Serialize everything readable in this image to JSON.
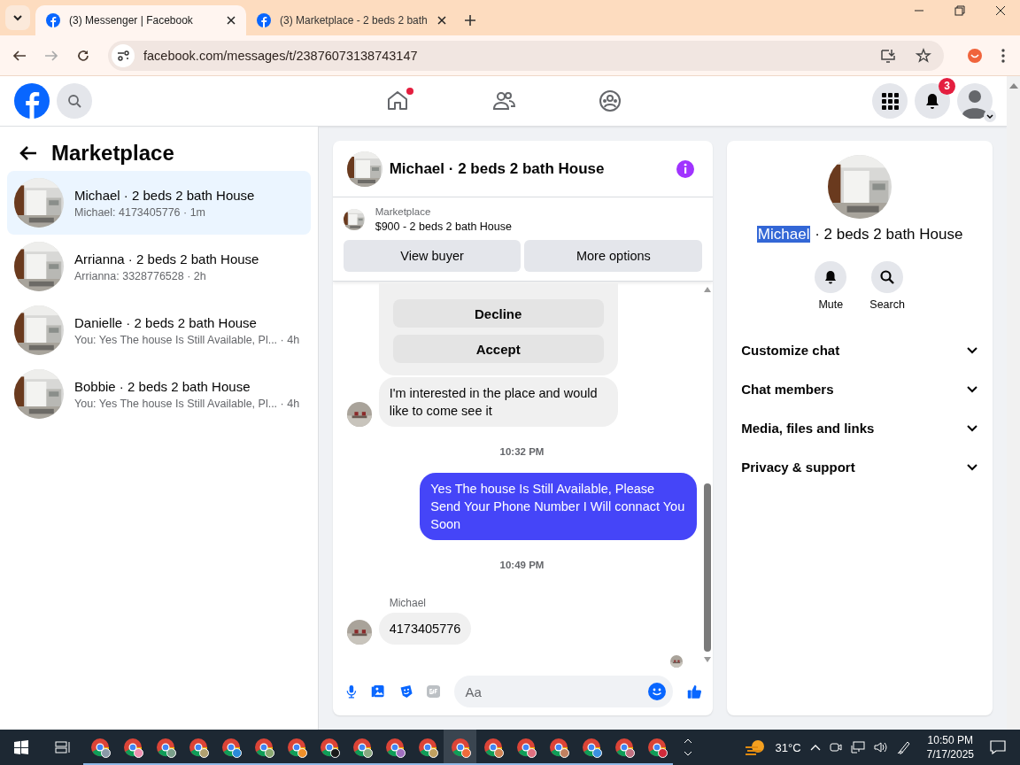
{
  "browser": {
    "tabs": [
      {
        "title": "(3) Messenger | Facebook",
        "selected": true
      },
      {
        "title": "(3) Marketplace - 2 beds 2 bath",
        "selected": false
      }
    ],
    "url": "facebook.com/messages/t/23876073138743147"
  },
  "nav": [
    {
      "kind": "home",
      "selected": false,
      "dot": true
    },
    {
      "kind": "friends",
      "selected": false,
      "dot": false
    },
    {
      "kind": "groups",
      "selected": false,
      "dot": false
    }
  ],
  "notifications": {
    "count": "3"
  },
  "sidebar": {
    "title": "Marketplace",
    "items": [
      {
        "title": "Michael · 2 beds 2 bath House",
        "preview": "Michael: 4173405776 · 1m",
        "selected": true
      },
      {
        "title": "Arrianna · 2 beds 2 bath House",
        "preview": "Arrianna: 3328776528 · 2h",
        "selected": false
      },
      {
        "title": "Danielle · 2 beds 2 bath House",
        "preview": "You: Yes The house Is Still Available, Pl... · 4h",
        "selected": false
      },
      {
        "title": "Bobbie · 2 beds 2 bath House",
        "preview": "You: Yes The house Is Still Available, Pl... · 4h",
        "selected": false
      }
    ]
  },
  "chat": {
    "title": "Michael · 2 beds 2 bath House",
    "listing": {
      "source": "Marketplace",
      "price": "$900 - 2 beds 2 bath House",
      "buttons": [
        "View buyer",
        "More options"
      ]
    },
    "messages": [
      {
        "kind": "actions",
        "buttons": [
          "Decline",
          "Accept"
        ]
      },
      {
        "kind": "received",
        "text": "I'm interested in the place and would like to come see it"
      },
      {
        "kind": "time",
        "text": "10:32 PM"
      },
      {
        "kind": "sent",
        "text": "Yes The house Is Still Available, Please Send Your Phone Number I Will connact You Soon"
      },
      {
        "kind": "time",
        "text": "10:49 PM"
      },
      {
        "kind": "sender",
        "text": "Michael"
      },
      {
        "kind": "received",
        "text": "4173405776"
      },
      {
        "kind": "seen"
      }
    ],
    "composer": {
      "placeholder": "Aa"
    }
  },
  "details": {
    "name": "Michael",
    "name_selected": true,
    "title_rest": "· 2 beds 2 bath House",
    "actions": [
      {
        "kind": "mute",
        "label": "Mute"
      },
      {
        "kind": "search",
        "label": "Search"
      }
    ],
    "sections": [
      {
        "label": "Customize chat",
        "expanded": false
      },
      {
        "label": "Chat members",
        "expanded": false
      },
      {
        "label": "Media, files and links",
        "expanded": false
      },
      {
        "label": "Privacy & support",
        "expanded": false
      }
    ]
  },
  "taskbar": {
    "apps": [
      {
        "color": "#8a9aa8",
        "selected": false
      },
      {
        "color": "#f08fb0",
        "selected": false
      },
      {
        "color": "#7aa08a",
        "selected": false
      },
      {
        "color": "#b0a070",
        "selected": false
      },
      {
        "color": "#2a8ad8",
        "selected": false
      },
      {
        "color": "#8aa870",
        "selected": false
      },
      {
        "color": "#f0902a",
        "selected": false
      },
      {
        "color": "#1a1a1a",
        "selected": false
      },
      {
        "color": "#8aa880",
        "selected": false
      },
      {
        "color": "#a070c0",
        "selected": false
      },
      {
        "color": "#c0a060",
        "selected": false
      },
      {
        "color": "#f06a3a",
        "selected": true
      },
      {
        "color": "#d08050",
        "selected": false
      },
      {
        "color": "#e07080",
        "selected": false
      },
      {
        "color": "#c08060",
        "selected": false
      },
      {
        "color": "#3a90e0",
        "selected": false
      },
      {
        "color": "#c07080",
        "selected": false
      },
      {
        "color": "#d02a3a",
        "selected": false
      }
    ],
    "weather": "31°C",
    "time": "10:50 PM",
    "date": "7/17/2025"
  }
}
